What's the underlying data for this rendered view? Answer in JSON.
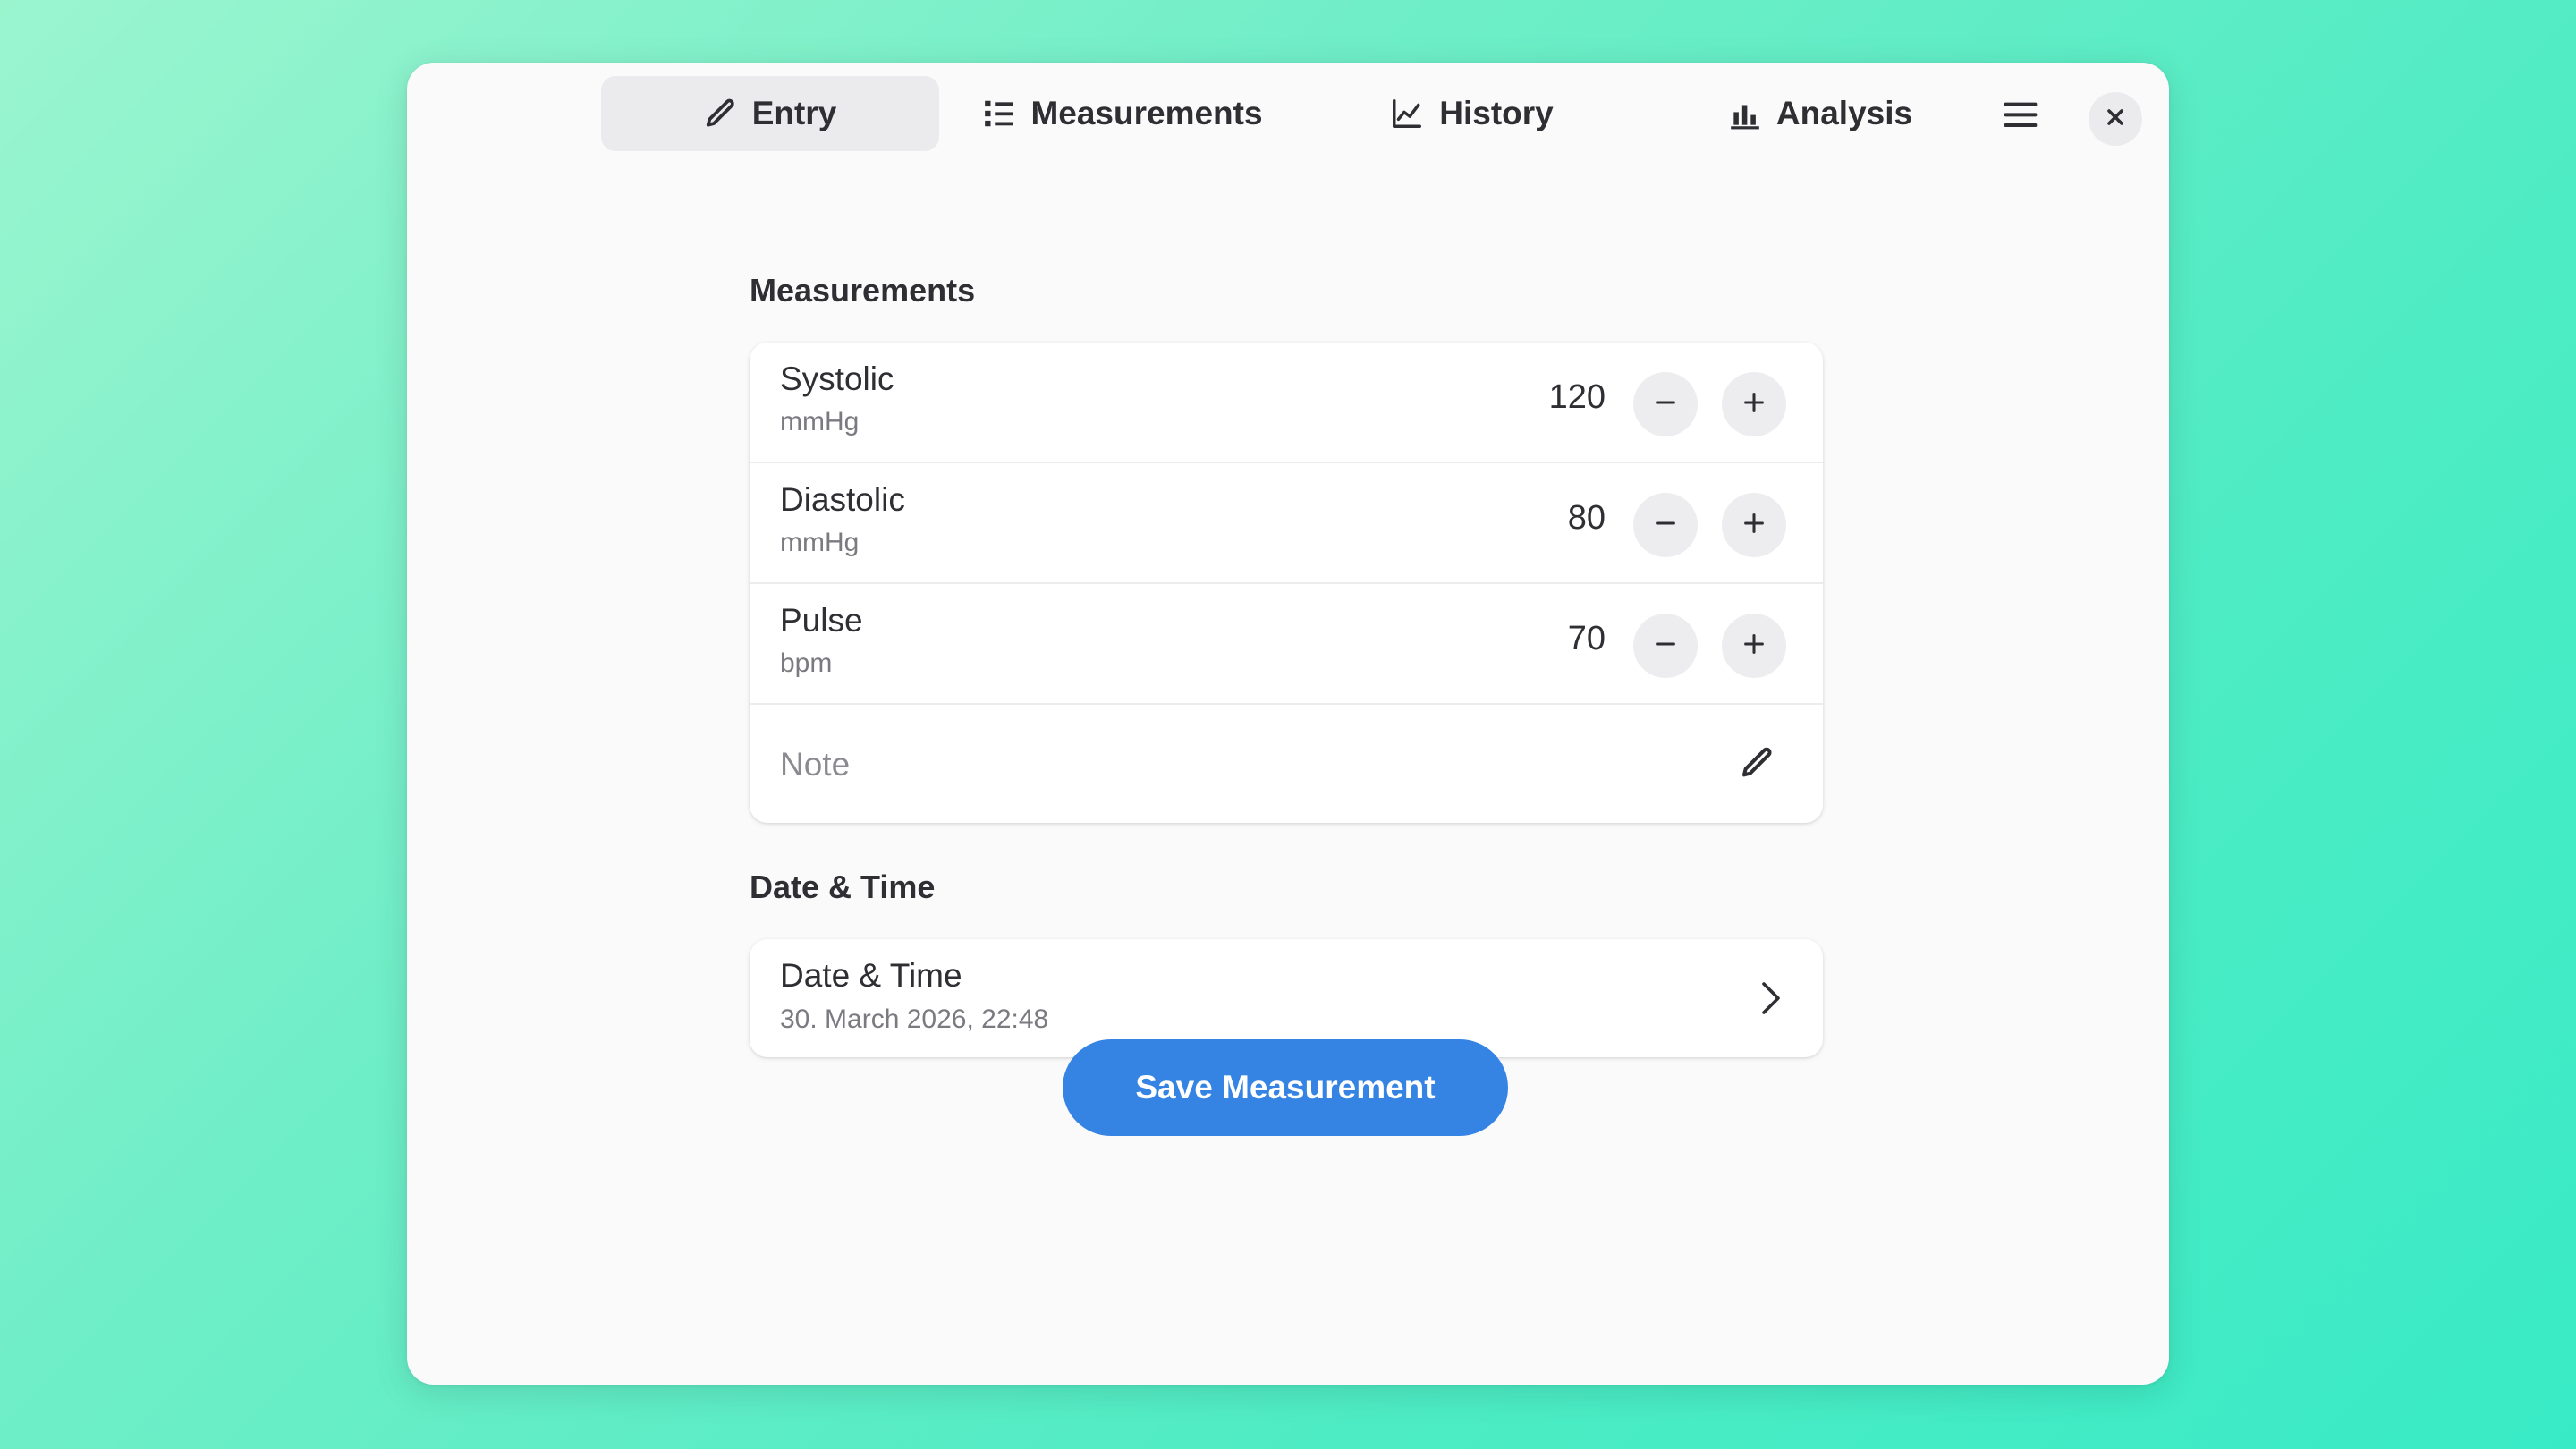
{
  "tabs": [
    {
      "label": "Entry",
      "icon": "pencil-icon",
      "active": true
    },
    {
      "label": "Measurements",
      "icon": "list-icon",
      "active": false
    },
    {
      "label": "History",
      "icon": "line-chart-icon",
      "active": false
    },
    {
      "label": "Analysis",
      "icon": "bar-chart-icon",
      "active": false
    }
  ],
  "header": {
    "menu_icon": "hamburger-menu-icon",
    "close_icon": "close-icon"
  },
  "measurements_section": {
    "title": "Measurements",
    "rows": [
      {
        "label": "Systolic",
        "unit": "mmHg",
        "value": "120"
      },
      {
        "label": "Diastolic",
        "unit": "mmHg",
        "value": "80"
      },
      {
        "label": "Pulse",
        "unit": "bpm",
        "value": "70"
      }
    ],
    "note": {
      "placeholder": "Note"
    }
  },
  "datetime_section": {
    "title": "Date & Time",
    "label": "Date & Time",
    "value": "30. March 2026, 22:48"
  },
  "save_button": {
    "label": "Save Measurement"
  },
  "colors": {
    "accent": "#3584e4",
    "window_bg": "#fafafb"
  }
}
